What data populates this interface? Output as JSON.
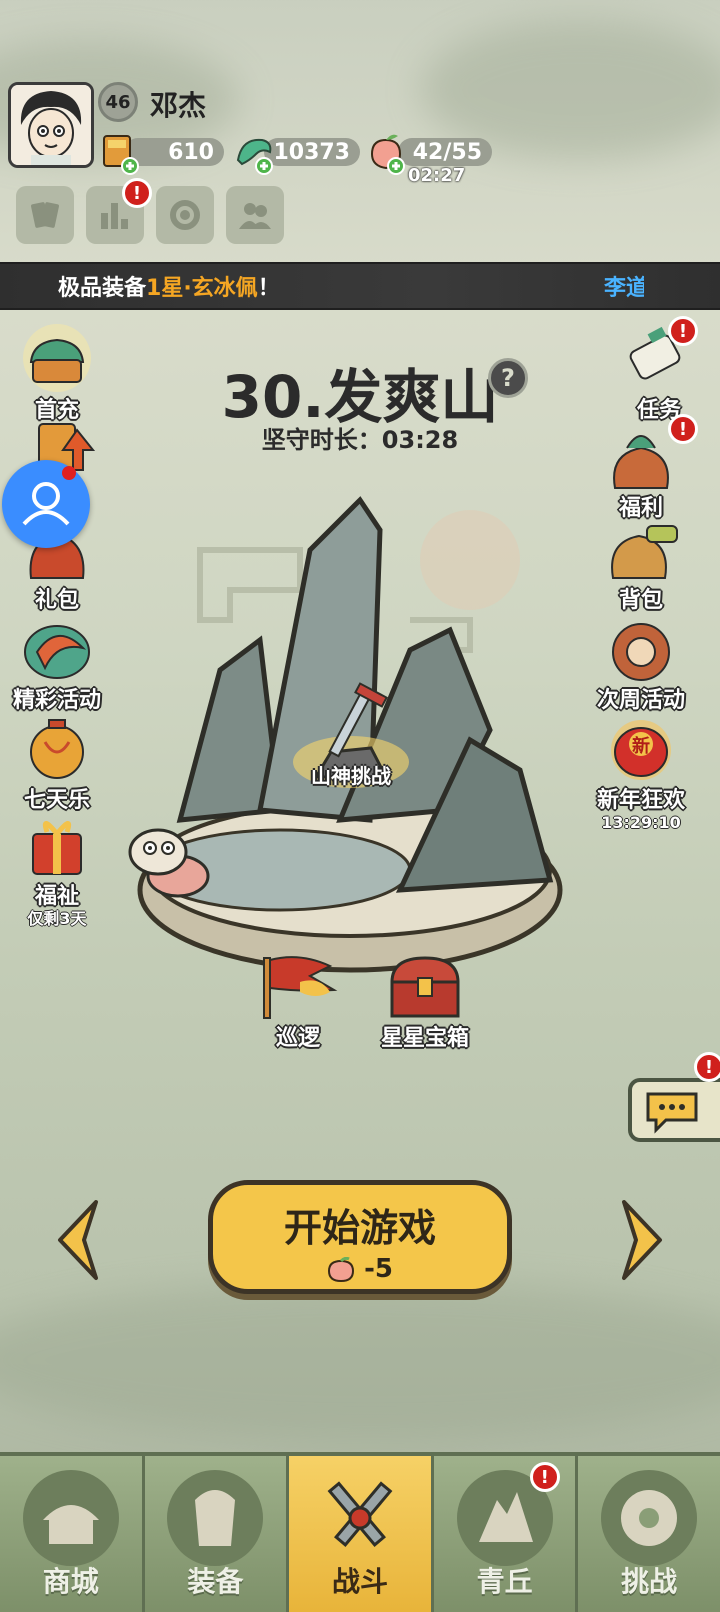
{
  "player": {
    "level": "46",
    "name": "邓杰"
  },
  "resources": {
    "gold": "610",
    "jade": "10373",
    "stamina": "42/55",
    "stamina_timer": "02:27"
  },
  "ticker": {
    "prefix": "极品装备 ",
    "highlight": "1星·玄冰佩",
    "suffix": "！",
    "next_name": "李道"
  },
  "stage": {
    "title": "30.发爽山",
    "defend_label": "坚守时长：",
    "defend_time": "03:28",
    "challenge_label": "山神挑战"
  },
  "left_menu": [
    {
      "label": "首充",
      "icon": "first-recharge-icon"
    },
    {
      "label": "",
      "icon": "upgrade-icon"
    },
    {
      "label": "礼包",
      "icon": "gift-pack-icon"
    },
    {
      "label": "精彩活动",
      "icon": "events-icon"
    },
    {
      "label": "七天乐",
      "icon": "seven-days-icon"
    },
    {
      "label": "福祉",
      "sub": "仅剩3天",
      "icon": "blessing-icon"
    }
  ],
  "right_menu": [
    {
      "label": "任务",
      "icon": "task-scroll-icon"
    },
    {
      "label": "福利",
      "icon": "welfare-icon"
    },
    {
      "label": "背包",
      "icon": "backpack-icon"
    },
    {
      "label": "次周活动",
      "icon": "weekly-event-icon"
    },
    {
      "label": "新年狂欢",
      "sub": "13:29:10",
      "icon": "new-year-icon",
      "badge": "新"
    }
  ],
  "map_items": {
    "patrol": "巡逻",
    "star_chest": "星星宝箱"
  },
  "start": {
    "label": "开始游戏",
    "cost": "-5"
  },
  "nav": [
    {
      "label": "商城",
      "icon": "shop-icon"
    },
    {
      "label": "装备",
      "icon": "equipment-icon"
    },
    {
      "label": "战斗",
      "icon": "battle-icon",
      "active": true
    },
    {
      "label": "青丘",
      "icon": "qingqiu-icon"
    },
    {
      "label": "挑战",
      "icon": "challenge-icon"
    }
  ],
  "alerts": "!",
  "colors": {
    "accent": "#f4c64a",
    "alert": "#d0201c",
    "highlight": "#f5a623",
    "nav": "#8a9e77"
  }
}
